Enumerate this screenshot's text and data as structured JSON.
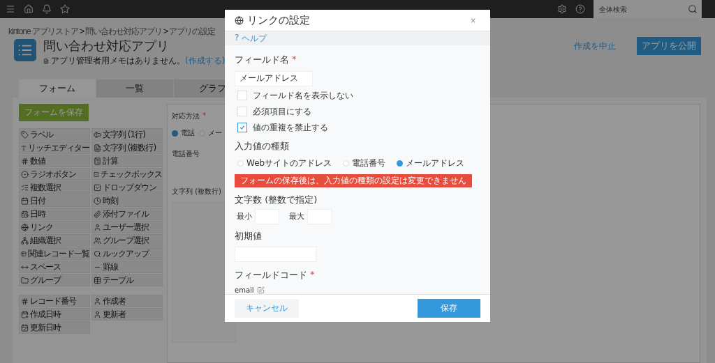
{
  "top_bar": {
    "search": {
      "placeholder": "全体検索"
    }
  },
  "breadcrumb": [
    {
      "label": "kintone アプリストア",
      "separator": ">"
    },
    {
      "label": "問い合わせ対応アプリ",
      "separator": ">"
    },
    {
      "label": "アプリの設定"
    }
  ],
  "app": {
    "title": "問い合わせ対応アプリ",
    "memo": "アプリ管理者用メモはありません。",
    "memo_link": "(作成する)"
  },
  "actions": {
    "cancel": "作成を中止",
    "publish": "アプリを公開"
  },
  "tabs": [
    {
      "label": "フォーム",
      "selected": true
    },
    {
      "label": "一覧",
      "selected": false
    },
    {
      "label": "グラフ",
      "selected": false
    }
  ],
  "palette": {
    "save": "フォームを保存",
    "fields": [
      "ラベル",
      "文字列 (1行)",
      "リッチエディター",
      "文字列 (複数行)",
      "数値",
      "計算",
      "ラジオボタン",
      "チェックボックス",
      "複数選択",
      "ドロップダウン",
      "日付",
      "時刻",
      "日時",
      "添付ファイル",
      "リンク",
      "ユーザー選択",
      "組織選択",
      "グループ選択",
      "関連レコード一覧",
      "ルックアップ",
      "スペース",
      "罫線",
      "グループ",
      "テーブル"
    ],
    "system_fields": [
      "レコード番号",
      "作成者",
      "作成日時",
      "更新者",
      "更新日時"
    ]
  },
  "canvas": {
    "fields": [
      {
        "kind": "radio",
        "label": "対応方法",
        "required_mark": "*",
        "options": [
          {
            "label": "電話",
            "selected": true
          },
          {
            "label": "メー",
            "selected": false
          }
        ]
      },
      {
        "kind": "text",
        "label": "電話番号"
      },
      {
        "kind": "textarea",
        "label": "文字列 (複数行)"
      }
    ]
  },
  "dialog": {
    "title": "リンクの設定",
    "close": "×",
    "help": {
      "mark": "?",
      "label": "ヘルプ"
    },
    "field_name": {
      "label": "フィールド名",
      "required_mark": "*",
      "value": "メールアドレス"
    },
    "options": [
      {
        "label": "フィールド名を表示しない",
        "checked": false
      },
      {
        "label": "必須項目にする",
        "checked": false
      },
      {
        "label": "値の重複を禁止する",
        "checked": true
      }
    ],
    "input_type": {
      "label": "入力値の種類",
      "choices": [
        {
          "label": "Webサイトのアドレス",
          "selected": false
        },
        {
          "label": "電話番号",
          "selected": false
        },
        {
          "label": "メールアドレス",
          "selected": true
        }
      ]
    },
    "warning": "フォームの保存後は、入力値の種類の設定は変更できません",
    "length": {
      "label": "文字数 (整数で指定)",
      "min_label": "最小",
      "max_label": "最大"
    },
    "default_value": {
      "label": "初期値"
    },
    "field_code": {
      "label": "フィールドコード",
      "required_mark": "*",
      "value": "email"
    },
    "buttons": {
      "cancel": "キャンセル",
      "save": "保存"
    }
  }
}
